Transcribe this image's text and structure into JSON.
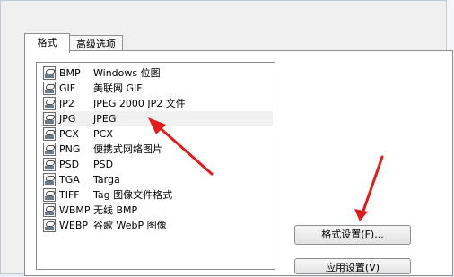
{
  "tabs": [
    {
      "label": "格式"
    },
    {
      "label": "高级选项"
    }
  ],
  "formats": [
    {
      "code": "BMP",
      "description": "Windows 位图",
      "icon": "bmp-file-icon"
    },
    {
      "code": "GIF",
      "description": "美联网 GIF",
      "icon": "gif-file-icon"
    },
    {
      "code": "JP2",
      "description": "JPEG 2000 JP2 文件",
      "icon": "jp2-file-icon"
    },
    {
      "code": "JPG",
      "description": "JPEG",
      "icon": "jpg-file-icon"
    },
    {
      "code": "PCX",
      "description": "PCX",
      "icon": "pcx-file-icon"
    },
    {
      "code": "PNG",
      "description": "便携式网络图片",
      "icon": "png-file-icon"
    },
    {
      "code": "PSD",
      "description": "PSD",
      "icon": "psd-file-icon"
    },
    {
      "code": "TGA",
      "description": "Targa",
      "icon": "tga-file-icon"
    },
    {
      "code": "TIFF",
      "description": "Tag 图像文件格式",
      "icon": "tiff-file-icon"
    },
    {
      "code": "WBMP",
      "description": "无线 BMP",
      "icon": "wbmp-file-icon"
    },
    {
      "code": "WEBP",
      "description": "谷歌 WebP 图像",
      "icon": "webp-file-icon"
    }
  ],
  "selected_format": "JPG",
  "buttons": {
    "format_settings": "格式设置(F)...",
    "apply_settings": "应用设置(V)"
  },
  "colors": {
    "annotation_arrow": "#e31b1b",
    "selection_row": "#f1f1f1"
  }
}
